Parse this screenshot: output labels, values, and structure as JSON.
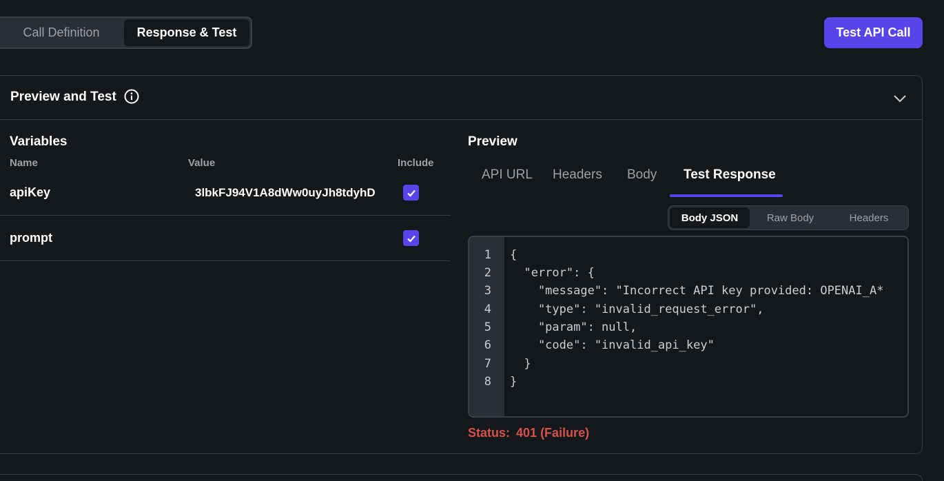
{
  "top_tabs": {
    "call_definition": "Call Definition",
    "response_test": "Response & Test"
  },
  "test_button_label": "Test API Call",
  "panel": {
    "title": "Preview and Test"
  },
  "variables": {
    "title": "Variables",
    "headers": {
      "name": "Name",
      "value": "Value",
      "include": "Include"
    },
    "rows": [
      {
        "name": "apiKey",
        "value": "3lbkFJ94V1A8dWw0uyJh8tdyhD",
        "include": true
      },
      {
        "name": "prompt",
        "value": "",
        "include": true
      }
    ]
  },
  "preview": {
    "title": "Preview",
    "tabs": [
      "API URL",
      "Headers",
      "Body",
      "Test Response"
    ],
    "active_tab": "Test Response",
    "sub_tabs": [
      "Body JSON",
      "Raw Body",
      "Headers"
    ],
    "active_sub_tab": "Body JSON",
    "code_lines": [
      "{",
      "  \"error\": {",
      "    \"message\": \"Incorrect API key provided: OPENAI_A*",
      "    \"type\": \"invalid_request_error\",",
      "    \"param\": null,",
      "    \"code\": \"invalid_api_key\"",
      "  }",
      "}"
    ],
    "line_numbers": [
      "1",
      "2",
      "3",
      "4",
      "5",
      "6",
      "7",
      "8"
    ],
    "status_label": "Status:",
    "status_value": "401 (Failure)"
  },
  "colors": {
    "accent": "#5a43e8",
    "error": "#d4524b",
    "background": "#14181b"
  }
}
